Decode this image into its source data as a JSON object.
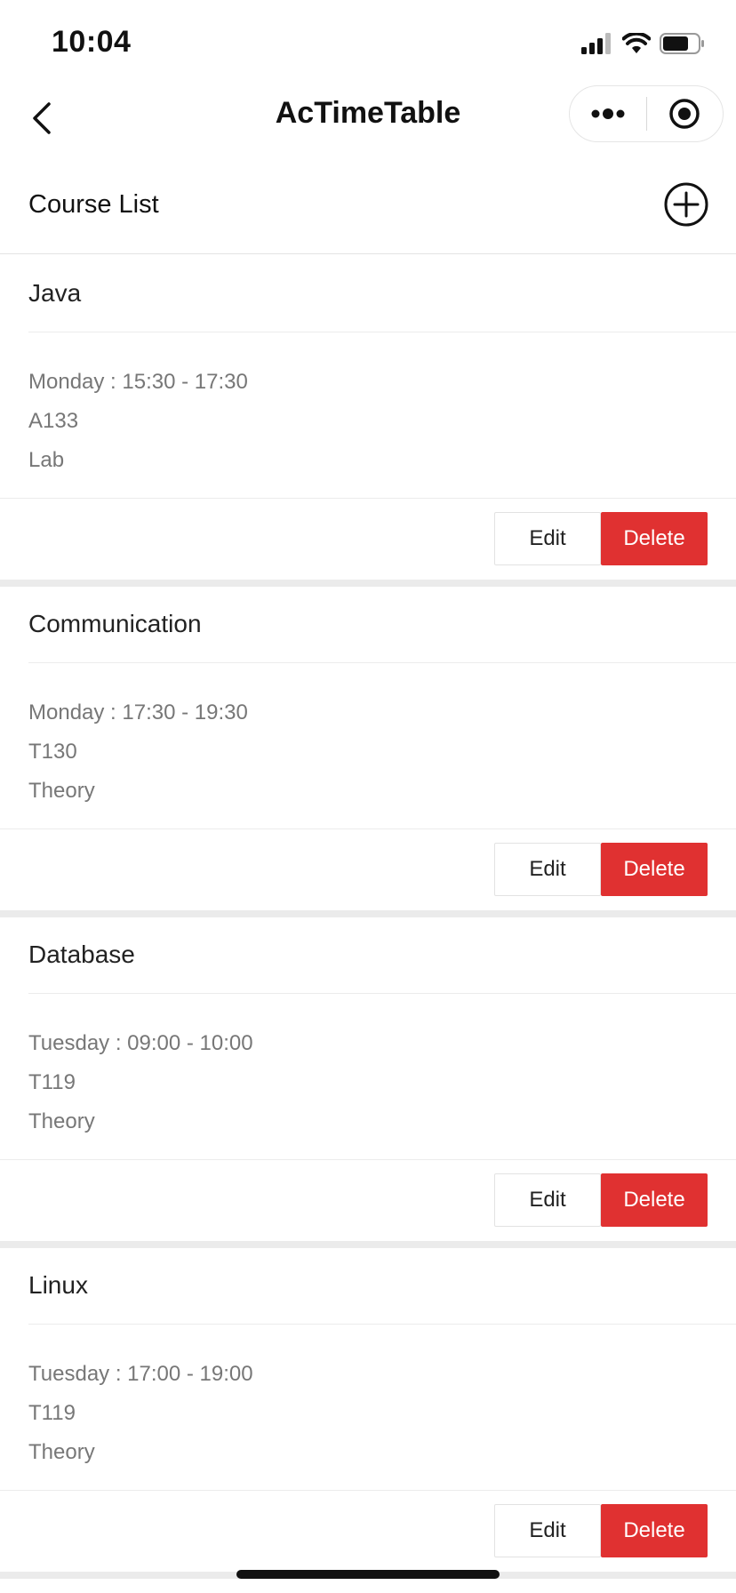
{
  "status_bar": {
    "time": "10:04",
    "icons": [
      "signal-icon",
      "wifi-icon",
      "battery-icon"
    ]
  },
  "nav": {
    "title": "AcTimeTable",
    "icons": [
      "back-chevron-icon",
      "more-dots-icon",
      "close-target-icon"
    ]
  },
  "list": {
    "title": "Course List",
    "add_icon": "plus-circle-icon"
  },
  "colors": {
    "delete_bg": "#e03131",
    "divider": "#ebebeb"
  },
  "courses": [
    {
      "name": "Java",
      "schedule": "Monday : 15:30 - 17:30",
      "room": "A133",
      "type": "Lab",
      "edit_label": "Edit",
      "delete_label": "Delete"
    },
    {
      "name": "Communication",
      "schedule": "Monday : 17:30 - 19:30",
      "room": "T130",
      "type": "Theory",
      "edit_label": "Edit",
      "delete_label": "Delete"
    },
    {
      "name": "Database",
      "schedule": "Tuesday : 09:00 - 10:00",
      "room": "T119",
      "type": "Theory",
      "edit_label": "Edit",
      "delete_label": "Delete"
    },
    {
      "name": "Linux",
      "schedule": "Tuesday : 17:00 - 19:00",
      "room": "T119",
      "type": "Theory",
      "edit_label": "Edit",
      "delete_label": "Delete"
    }
  ]
}
